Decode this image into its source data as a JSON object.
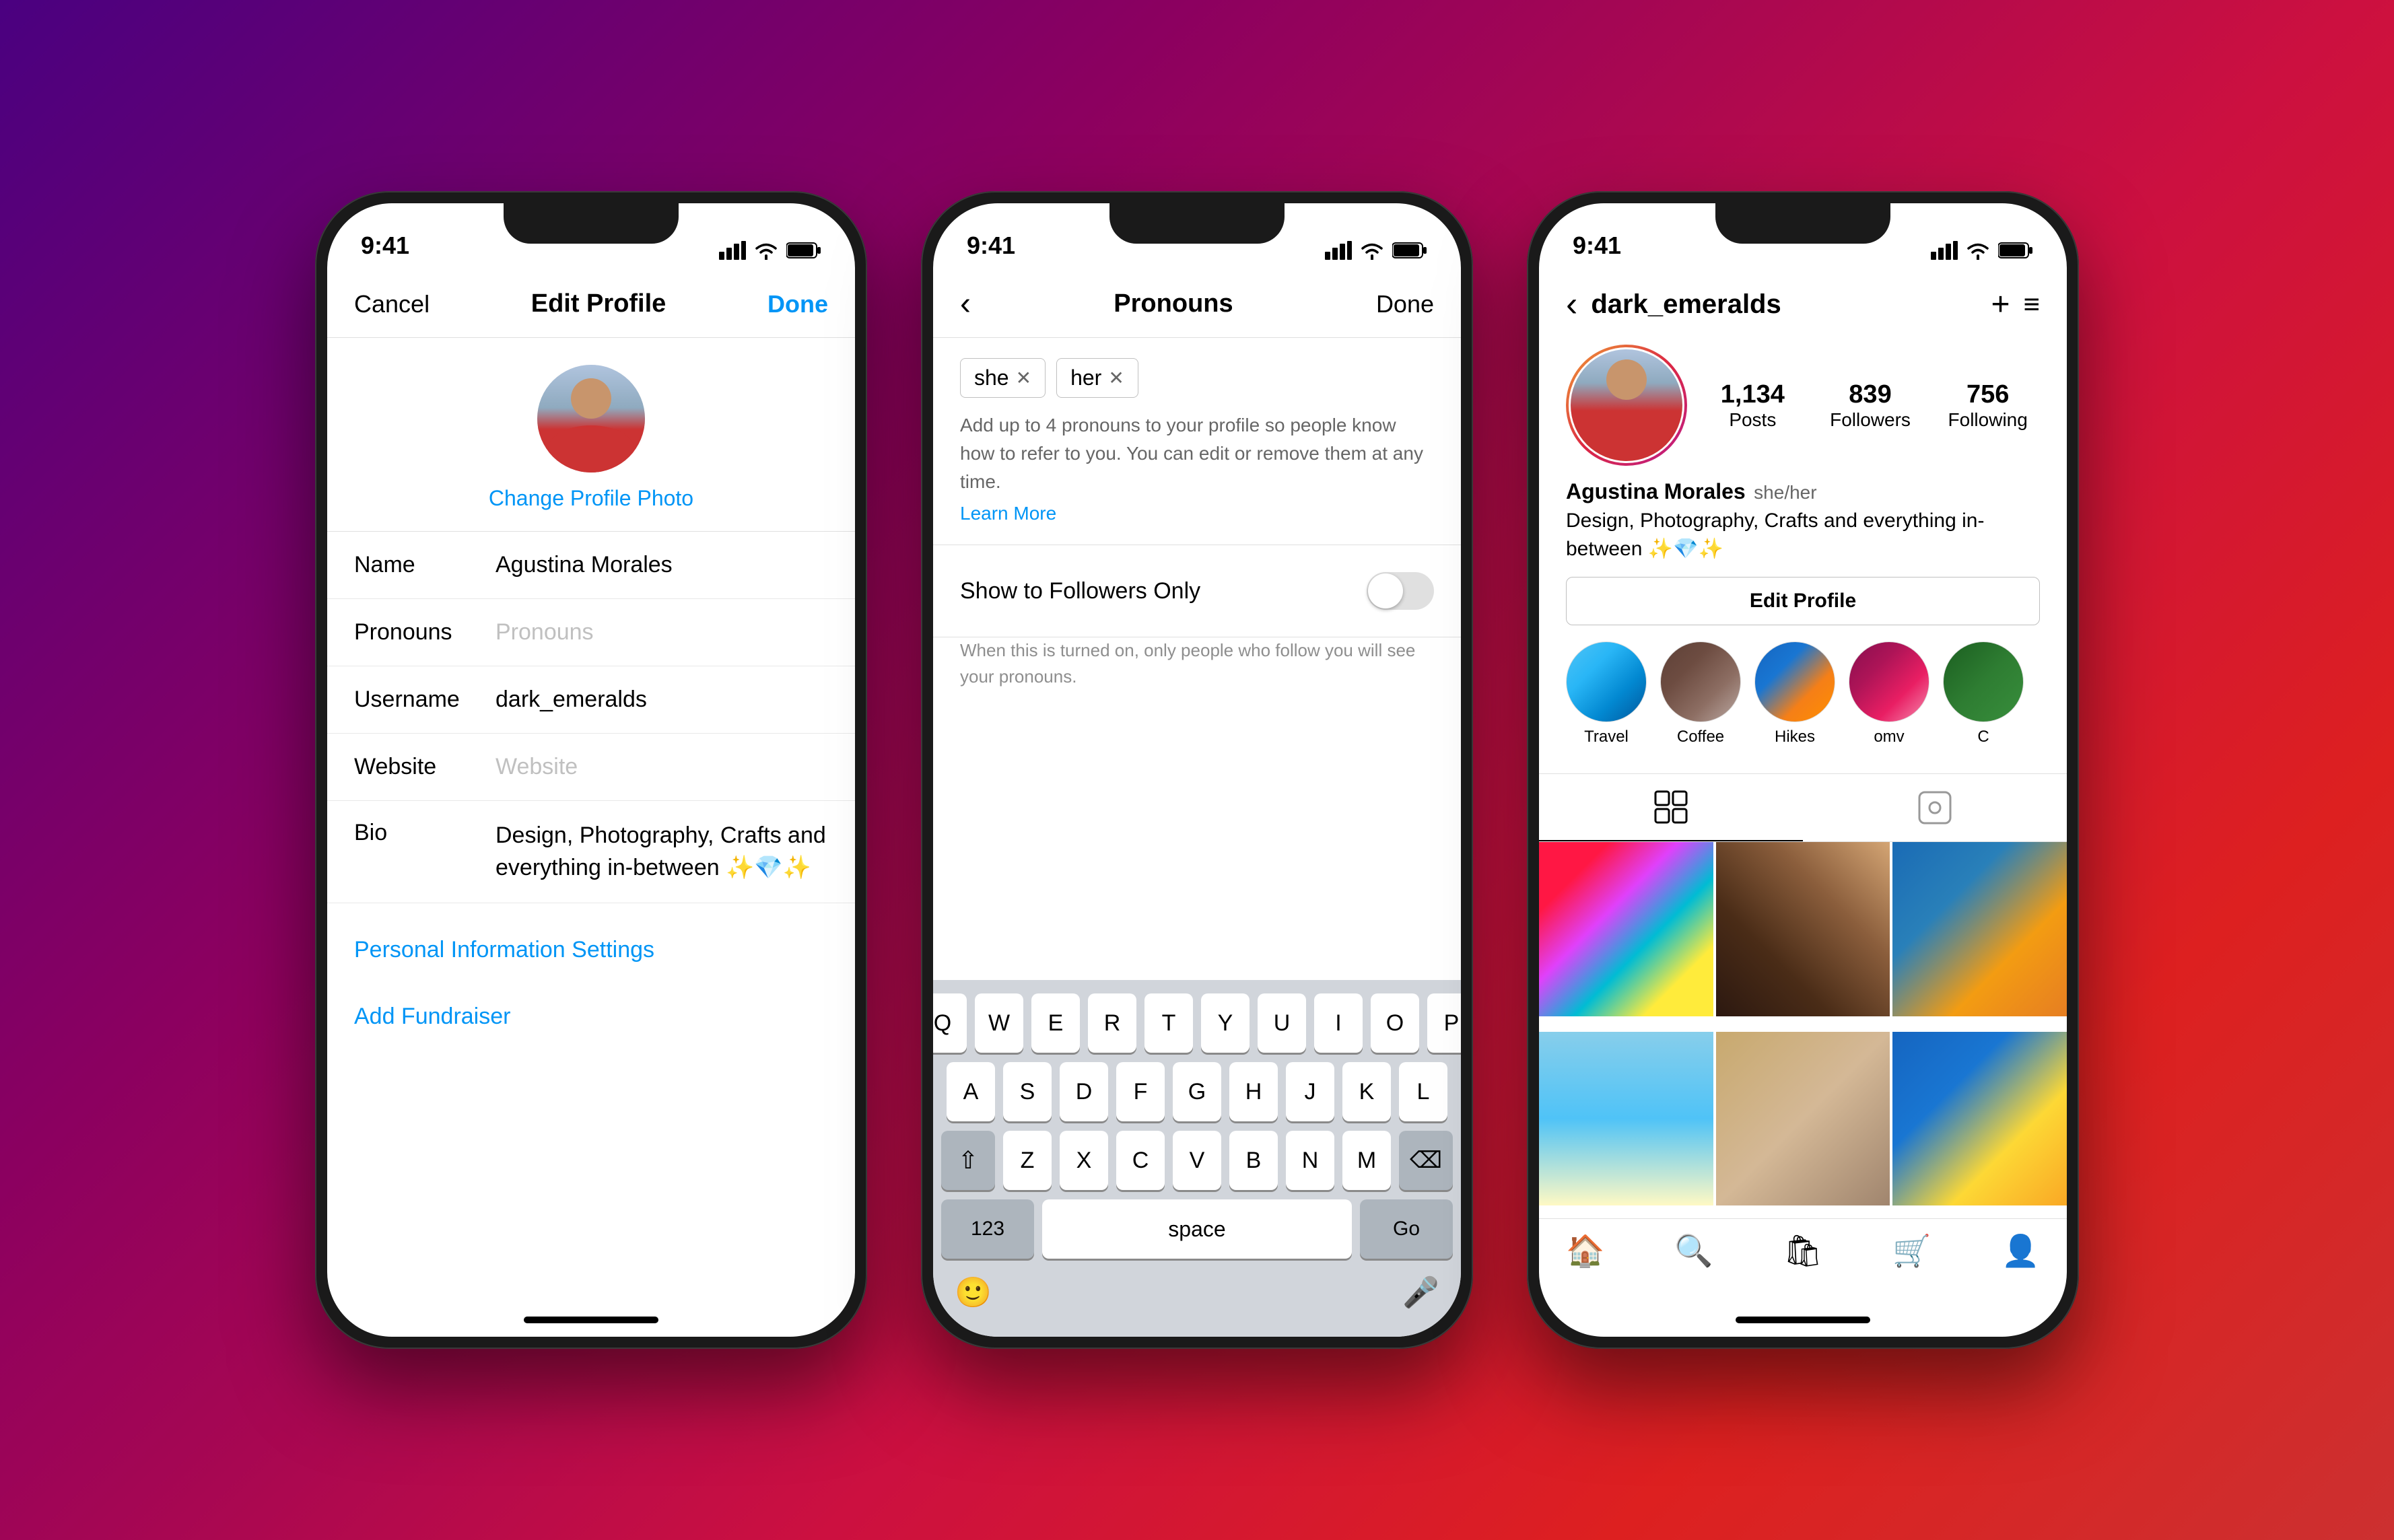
{
  "phone1": {
    "status": {
      "time": "9:41"
    },
    "nav": {
      "cancel": "Cancel",
      "title": "Edit Profile",
      "done": "Done"
    },
    "profile": {
      "change_photo": "Change Profile Photo"
    },
    "fields": [
      {
        "label": "Name",
        "value": "Agustina Morales",
        "placeholder": ""
      },
      {
        "label": "Pronouns",
        "value": "",
        "placeholder": "Pronouns"
      },
      {
        "label": "Username",
        "value": "dark_emeralds",
        "placeholder": ""
      },
      {
        "label": "Website",
        "value": "",
        "placeholder": "Website"
      },
      {
        "label": "Bio",
        "value": "Design, Photography, Crafts and everything in-between ✨💎✨",
        "placeholder": ""
      }
    ],
    "links": [
      "Personal Information Settings",
      "Add Fundraiser"
    ]
  },
  "phone2": {
    "status": {
      "time": "9:41"
    },
    "nav": {
      "back": "‹",
      "title": "Pronouns",
      "done": "Done"
    },
    "tags": [
      "she",
      "her"
    ],
    "help_text": "Add up to 4 pronouns to your profile so people know how to refer to you. You can edit or remove them at any time.",
    "learn_more": "Learn More",
    "show_followers_label": "Show to Followers Only",
    "show_followers_desc": "When this is turned on, only people who follow you will see your pronouns.",
    "keyboard": {
      "row1": [
        "Q",
        "W",
        "E",
        "R",
        "T",
        "Y",
        "U",
        "I",
        "O",
        "P"
      ],
      "row2": [
        "A",
        "S",
        "D",
        "F",
        "G",
        "H",
        "J",
        "K",
        "L"
      ],
      "row3": [
        "Z",
        "X",
        "C",
        "V",
        "B",
        "N",
        "M"
      ],
      "space": "space",
      "go": "Go",
      "num": "123"
    }
  },
  "phone3": {
    "status": {
      "time": "9:41"
    },
    "nav": {
      "back": "‹",
      "username": "dark_emeralds",
      "add": "+",
      "menu": "≡"
    },
    "stats": {
      "posts_count": "1,134",
      "posts_label": "Posts",
      "followers_count": "839",
      "followers_label": "Followers",
      "following_count": "756",
      "following_label": "Following"
    },
    "profile": {
      "name": "Agustina Morales",
      "pronouns": "she/her",
      "bio": "Design, Photography, Crafts and everything in-between ✨💎✨"
    },
    "edit_btn": "Edit Profile",
    "highlights": [
      {
        "label": "Travel"
      },
      {
        "label": "Coffee"
      },
      {
        "label": "Hikes"
      },
      {
        "label": "omv"
      },
      {
        "label": "C"
      }
    ]
  }
}
